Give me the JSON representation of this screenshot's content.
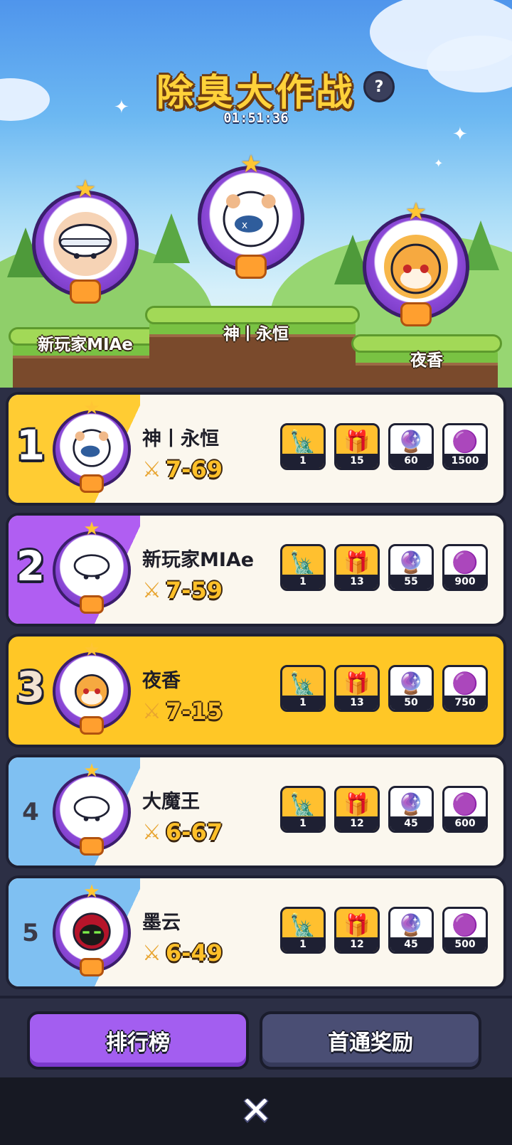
{
  "event": {
    "title": "除臭大作战",
    "help_label": "?",
    "timer": "01:51:36"
  },
  "podium": [
    {
      "place": 2,
      "name": "新玩家MIAe",
      "avatar_icon": "boy-cap-avatar-icon"
    },
    {
      "place": 1,
      "name": "神丨永恒",
      "avatar_icon": "hamster-avatar-icon"
    },
    {
      "place": 3,
      "name": "夜香",
      "avatar_icon": "shiba-avatar-icon"
    }
  ],
  "ranking": [
    {
      "rank": "1",
      "name": "神丨永恒",
      "score": "7-69",
      "rewards": [
        "1",
        "15",
        "60",
        "1500"
      ]
    },
    {
      "rank": "2",
      "name": "新玩家MIAe",
      "score": "7-59",
      "rewards": [
        "1",
        "13",
        "55",
        "900"
      ]
    },
    {
      "rank": "3",
      "name": "夜香",
      "score": "7-15",
      "rewards": [
        "1",
        "13",
        "50",
        "750"
      ]
    },
    {
      "rank": "4",
      "name": "大魔王",
      "score": "6-67",
      "rewards": [
        "1",
        "12",
        "45",
        "600"
      ]
    },
    {
      "rank": "5",
      "name": "墨云",
      "score": "6-49",
      "rewards": [
        "1",
        "12",
        "45",
        "500"
      ]
    }
  ],
  "reward_icons": [
    "statue-icon",
    "mystery-box-icon",
    "cat-orb-icon",
    "orb-pile-icon"
  ],
  "tabs": {
    "leaderboard": "排行榜",
    "first_clear": "首通奖励"
  },
  "close_label": "✕",
  "colors": {
    "accent_purple": "#a35ef0",
    "gold": "#ffc726",
    "title_yellow": "#ffd23a"
  }
}
